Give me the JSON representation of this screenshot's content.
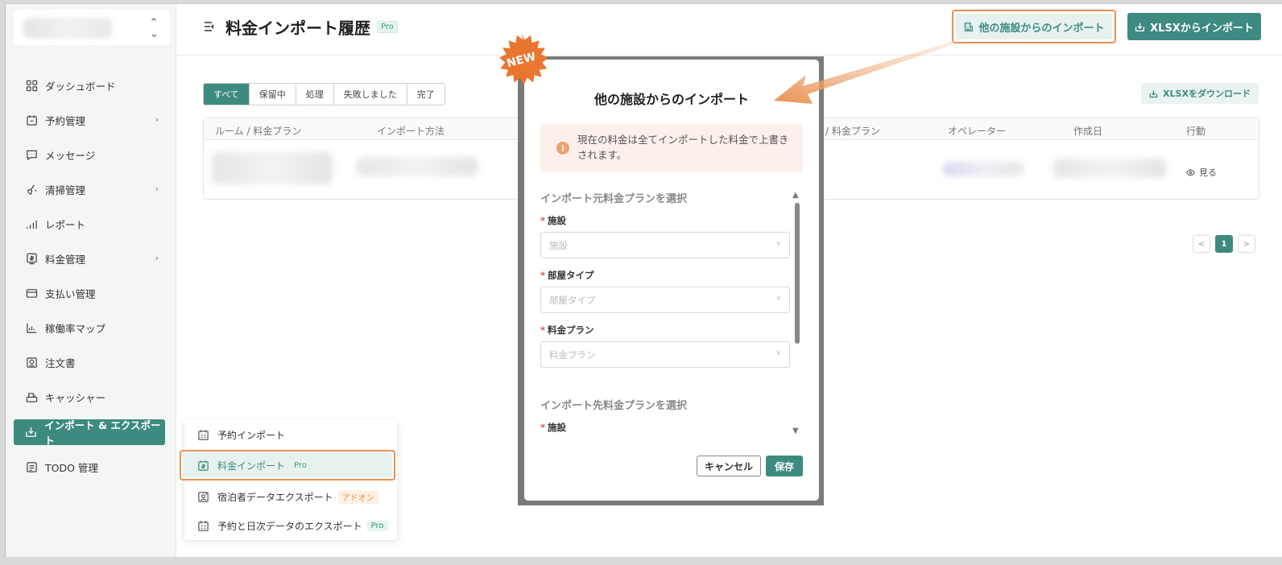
{
  "sidebar": {
    "items": [
      {
        "label": "ダッシュボード",
        "icon": "dashboard-icon",
        "chevron": false
      },
      {
        "label": "予約管理",
        "icon": "calendar-icon",
        "chevron": true
      },
      {
        "label": "メッセージ",
        "icon": "message-icon",
        "chevron": false
      },
      {
        "label": "清掃管理",
        "icon": "broom-icon",
        "chevron": true
      },
      {
        "label": "レポート",
        "icon": "chart-icon",
        "chevron": false
      },
      {
        "label": "料金管理",
        "icon": "price-icon",
        "chevron": true
      },
      {
        "label": "支払い管理",
        "icon": "card-icon",
        "chevron": false
      },
      {
        "label": "稼働率マップ",
        "icon": "occupancy-icon",
        "chevron": false
      },
      {
        "label": "注文書",
        "icon": "order-icon",
        "chevron": false
      },
      {
        "label": "キャッシャー",
        "icon": "cashier-icon",
        "chevron": false
      },
      {
        "label": "インポート & エクスポート",
        "icon": "import-export-icon",
        "chevron": false,
        "active": true
      },
      {
        "label": "TODO 管理",
        "icon": "todo-icon",
        "chevron": false
      }
    ]
  },
  "header": {
    "title": "料金インポート履歴",
    "pro": "Pro",
    "btn_other": "他の施設からのインポート",
    "btn_xlsx": "XLSXからインポート"
  },
  "filters": [
    "すべて",
    "保留中",
    "処理",
    "失敗しました",
    "完了"
  ],
  "download": "XLSXをダウンロード",
  "table": {
    "headers": [
      "ルーム / 料金プラン",
      "インポート方法",
      "/ 料金プラン",
      "オペレーター",
      "作成日",
      "行動"
    ],
    "view": "見る"
  },
  "pager": {
    "prev": "<",
    "page": "1",
    "next": ">"
  },
  "menu": {
    "items": [
      {
        "label": "予約インポート",
        "tag": ""
      },
      {
        "label": "料金インポート",
        "tag": "Pro"
      },
      {
        "label": "宿泊者データエクスポート",
        "tag": "アドオン"
      },
      {
        "label": "予約と日次データのエクスポート",
        "tag": "Pro"
      }
    ]
  },
  "modal": {
    "title": "他の施設からのインポート",
    "alert": "現在の料金は全てインポートした料金で上書きされます。",
    "source_section": "インポート元料金プランを選択",
    "target_section": "インポート先料金プランを選択",
    "req": "*",
    "fields": [
      {
        "label": "施設",
        "placeholder": "施設"
      },
      {
        "label": "部屋タイプ",
        "placeholder": "部屋タイプ"
      },
      {
        "label": "料金プラン",
        "placeholder": "料金プラン"
      }
    ],
    "target_field": "施設",
    "cancel": "キャンセル",
    "save": "保存"
  },
  "new_badge": "NEW",
  "colors": {
    "accent": "#3d8a80",
    "highlight": "#e89152",
    "new": "#e8762f"
  }
}
